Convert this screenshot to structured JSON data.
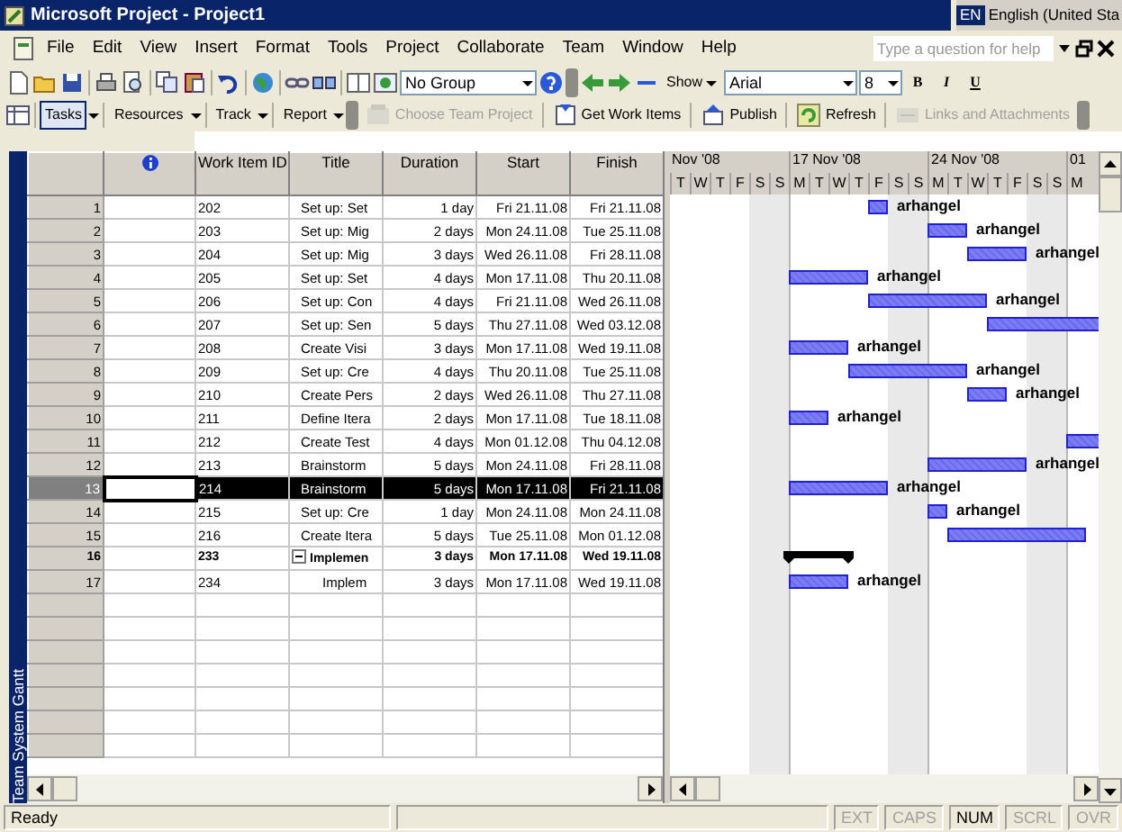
{
  "window": {
    "title": "Microsoft Project - Project1"
  },
  "language_bar": {
    "code": "EN",
    "language": "English (United Sta"
  },
  "menu": [
    "File",
    "Edit",
    "View",
    "Insert",
    "Format",
    "Tools",
    "Project",
    "Collaborate",
    "Team",
    "Window",
    "Help"
  ],
  "help_box": {
    "placeholder": "Type a question for help"
  },
  "standard_toolbar": {
    "group": "No Group",
    "show": "Show",
    "font": "Arial",
    "font_size": "8",
    "format_buttons": [
      {
        "kind": "bold",
        "label": "B"
      },
      {
        "kind": "italic",
        "label": "I"
      },
      {
        "kind": "underline",
        "label": "U"
      }
    ]
  },
  "team_toolbar": {
    "views": [
      {
        "label": "Tasks",
        "selected": true
      },
      {
        "label": "Resources",
        "selected": false
      },
      {
        "label": "Track",
        "selected": false
      },
      {
        "label": "Report",
        "selected": false
      }
    ],
    "actions": [
      {
        "kind": "choose",
        "label": "Choose Team Project",
        "disabled": true
      },
      {
        "kind": "get",
        "label": "Get Work Items",
        "disabled": false
      },
      {
        "kind": "publish",
        "label": "Publish",
        "disabled": false
      },
      {
        "kind": "refresh",
        "label": "Refresh",
        "disabled": false
      },
      {
        "kind": "links",
        "label": "Links and Attachments",
        "disabled": true
      }
    ]
  },
  "view_bar": {
    "label": "Team System Gantt"
  },
  "table": {
    "columns": [
      "Work Item ID",
      "Title",
      "Duration",
      "Start",
      "Finish"
    ],
    "rows": [
      {
        "number": "1",
        "id": "202",
        "title": "Set up: Set",
        "duration": "1 day",
        "start": "Fri 21.11.08",
        "finish": "Fri 21.11.08",
        "resource": "arhangel",
        "selected": false
      },
      {
        "number": "2",
        "id": "203",
        "title": "Set up: Mig",
        "duration": "2 days",
        "start": "Mon 24.11.08",
        "finish": "Tue 25.11.08",
        "resource": "arhangel",
        "selected": false
      },
      {
        "number": "3",
        "id": "204",
        "title": "Set up: Mig",
        "duration": "3 days",
        "start": "Wed 26.11.08",
        "finish": "Fri 28.11.08",
        "resource": "arhangel",
        "selected": false
      },
      {
        "number": "4",
        "id": "205",
        "title": "Set up: Set",
        "duration": "4 days",
        "start": "Mon 17.11.08",
        "finish": "Thu 20.11.08",
        "resource": "arhangel",
        "selected": false
      },
      {
        "number": "5",
        "id": "206",
        "title": "Set up: Con",
        "duration": "4 days",
        "start": "Fri 21.11.08",
        "finish": "Wed 26.11.08",
        "resource": "arhangel",
        "selected": false
      },
      {
        "number": "6",
        "id": "207",
        "title": "Set up: Sen",
        "duration": "5 days",
        "start": "Thu 27.11.08",
        "finish": "Wed 03.12.08",
        "selected": false
      },
      {
        "number": "7",
        "id": "208",
        "title": "Create Visi",
        "duration": "3 days",
        "start": "Mon 17.11.08",
        "finish": "Wed 19.11.08",
        "resource": "arhangel",
        "selected": false
      },
      {
        "number": "8",
        "id": "209",
        "title": "Set up: Cre",
        "duration": "4 days",
        "start": "Thu 20.11.08",
        "finish": "Tue 25.11.08",
        "resource": "arhangel",
        "selected": false
      },
      {
        "number": "9",
        "id": "210",
        "title": "Create Pers",
        "duration": "2 days",
        "start": "Wed 26.11.08",
        "finish": "Thu 27.11.08",
        "resource": "arhangel",
        "selected": false
      },
      {
        "number": "10",
        "id": "211",
        "title": "Define Itera",
        "duration": "2 days",
        "start": "Mon 17.11.08",
        "finish": "Tue 18.11.08",
        "resource": "arhangel",
        "selected": false
      },
      {
        "number": "11",
        "id": "212",
        "title": "Create Test",
        "duration": "4 days",
        "start": "Mon 01.12.08",
        "finish": "Thu 04.12.08",
        "selected": false
      },
      {
        "number": "12",
        "id": "213",
        "title": "Brainstorm",
        "duration": "5 days",
        "start": "Mon 24.11.08",
        "finish": "Fri 28.11.08",
        "resource": "arhangel",
        "selected": false
      },
      {
        "number": "13",
        "id": "214",
        "title": "Brainstorm",
        "duration": "5 days",
        "start": "Mon 17.11.08",
        "finish": "Fri 21.11.08",
        "resource": "arhangel",
        "selected": true
      },
      {
        "number": "14",
        "id": "215",
        "title": "Set up: Cre",
        "duration": "1 day",
        "start": "Mon 24.11.08",
        "finish": "Mon 24.11.08",
        "resource": "arhangel",
        "selected": false
      },
      {
        "number": "15",
        "id": "216",
        "title": "Create Itera",
        "duration": "5 days",
        "start": "Tue 25.11.08",
        "finish": "Mon 01.12.08",
        "selected": false
      },
      {
        "number": "16",
        "id": "233",
        "title": "Implemen",
        "duration": "3 days",
        "start": "Mon 17.11.08",
        "finish": "Wed 19.11.08",
        "selected": false,
        "expanded": true,
        "children": [
          {
            "number": "17",
            "id": "234",
            "title": "Implem",
            "duration": "3 days",
            "start": "Mon 17.11.08",
            "finish": "Wed 19.11.08",
            "resource": "arhangel",
            "selected": false
          }
        ]
      }
    ]
  },
  "gantt": {
    "weeks": [
      "Nov '08",
      "17 Nov '08",
      "24 Nov '08",
      "01"
    ],
    "days": [
      "T",
      "W",
      "T",
      "F",
      "S",
      "S",
      "M",
      "T",
      "W",
      "T",
      "F",
      "S",
      "S",
      "M",
      "T",
      "W",
      "T",
      "F",
      "S",
      "S",
      "M"
    ]
  },
  "status_bar": {
    "text": "Ready",
    "indicators": [
      {
        "label": "EXT",
        "on": false
      },
      {
        "label": "CAPS",
        "on": false
      },
      {
        "label": "NUM",
        "on": true
      },
      {
        "label": "SCRL",
        "on": false
      },
      {
        "label": "OVR",
        "on": false
      }
    ]
  }
}
